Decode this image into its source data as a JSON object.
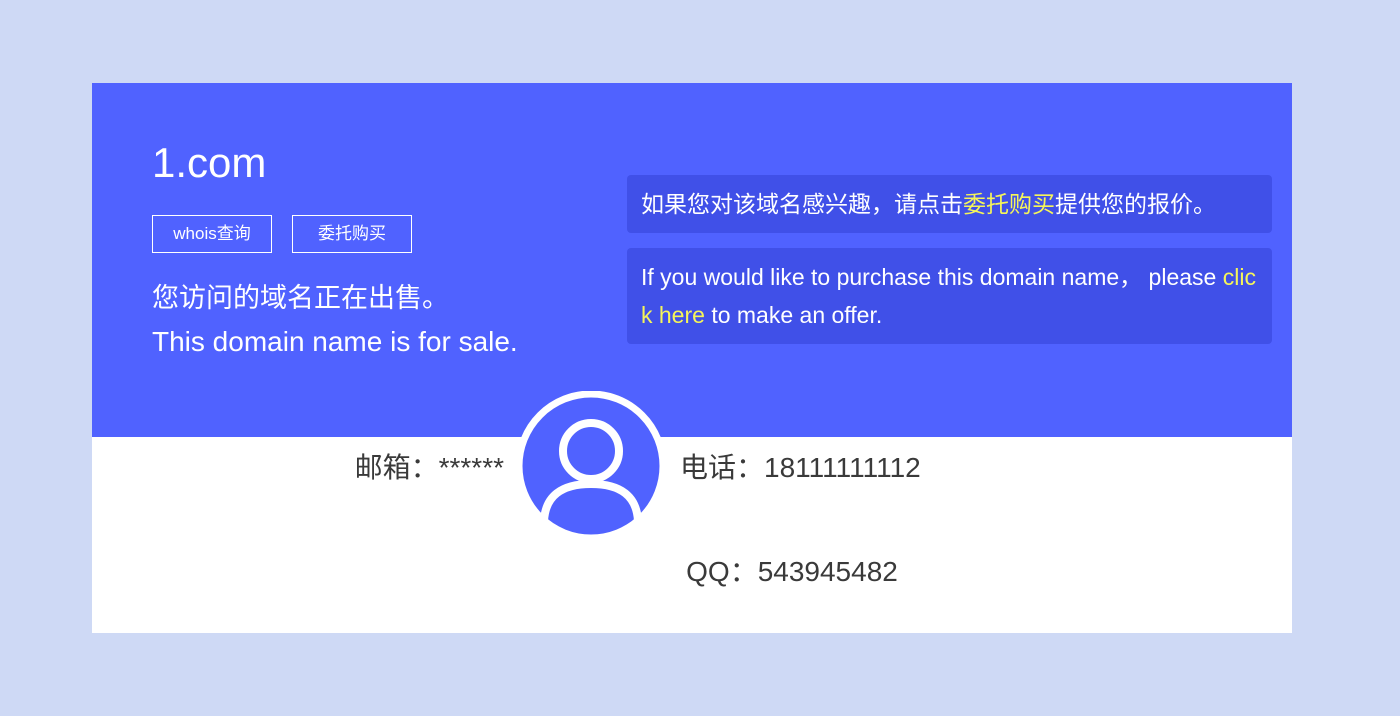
{
  "domain": "1.com",
  "buttons": {
    "whois": "whois查询",
    "entrust": "委托购买"
  },
  "sale": {
    "cn": "您访问的域名正在出售。",
    "en": "This domain name is for sale."
  },
  "info_cn": {
    "before": "如果您对该域名感兴趣，请点击",
    "link": "委托购买",
    "after": "提供您的报价。"
  },
  "info_en": {
    "before": "If you would like to purchase this domain name， please ",
    "link": "click here",
    "after": " to make an offer."
  },
  "contact": {
    "email": "邮箱：******",
    "phone": "电话：18111111112",
    "qq": "QQ：543945482"
  },
  "icons": {
    "avatar": "user-avatar-icon"
  },
  "colors": {
    "background": "#ced9f5",
    "hero": "#5062ff",
    "info_box": "#4050e8",
    "highlight": "#f5f55a",
    "text_dark": "#3a3a3a"
  }
}
